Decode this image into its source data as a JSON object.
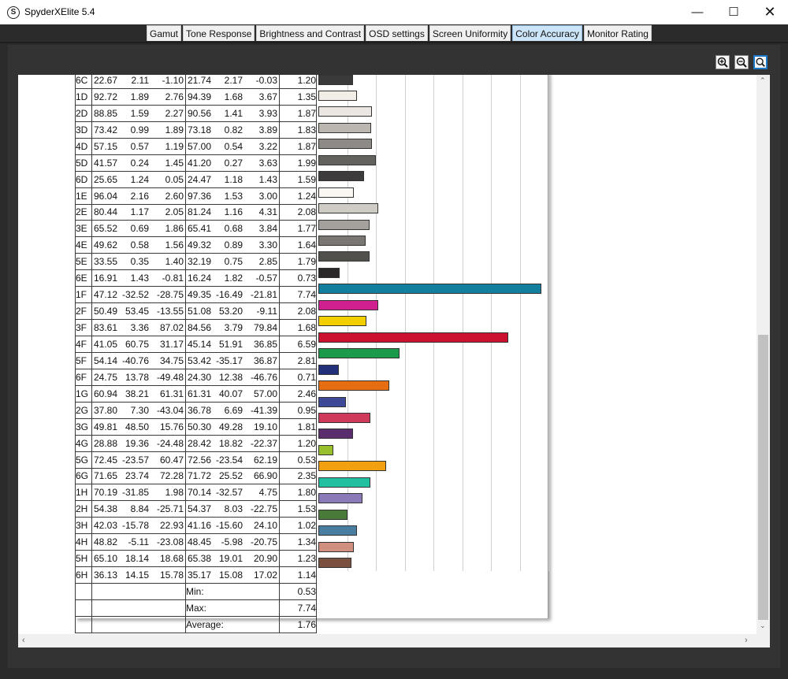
{
  "window": {
    "title": "SpyderXElite 5.4",
    "icon": "S",
    "buttons": {
      "minimize": "—",
      "maximize": "☐",
      "close": "✕"
    }
  },
  "tabs": [
    {
      "label": "Gamut",
      "active": false
    },
    {
      "label": "Tone Response",
      "active": false
    },
    {
      "label": "Brightness and Contrast",
      "active": false
    },
    {
      "label": "OSD settings",
      "active": false
    },
    {
      "label": "Screen Uniformity",
      "active": false
    },
    {
      "label": "Color Accuracy",
      "active": true
    },
    {
      "label": "Monitor Rating",
      "active": false
    }
  ],
  "zoom_controls": [
    "zoom-in-icon",
    "zoom-out-icon",
    "zoom-fit-icon"
  ],
  "scrollbar": {
    "vertical_position": 0.83
  },
  "chart_data": {
    "type": "bar",
    "title": "",
    "xlim": [
      0,
      8
    ],
    "rows": [
      {
        "id": "6C",
        "L": "22.67",
        "a": "2.11",
        "b": "-1.10",
        "L2": "21.74",
        "a2": "2.17",
        "b2": "-0.03",
        "de": 1.2,
        "color": "#3a3a3a"
      },
      {
        "id": "1D",
        "L": "92.72",
        "a": "1.89",
        "b": "2.76",
        "L2": "94.39",
        "a2": "1.68",
        "b2": "3.67",
        "de": 1.35,
        "color": "#f3ede7"
      },
      {
        "id": "2D",
        "L": "88.85",
        "a": "1.59",
        "b": "2.27",
        "L2": "90.56",
        "a2": "1.41",
        "b2": "3.93",
        "de": 1.87,
        "color": "#ebe6e1"
      },
      {
        "id": "3D",
        "L": "73.42",
        "a": "0.99",
        "b": "1.89",
        "L2": "73.18",
        "a2": "0.82",
        "b2": "3.89",
        "de": 1.83,
        "color": "#bbb6b0"
      },
      {
        "id": "4D",
        "L": "57.15",
        "a": "0.57",
        "b": "1.19",
        "L2": "57.00",
        "a2": "0.54",
        "b2": "3.22",
        "de": 1.87,
        "color": "#8e8b86"
      },
      {
        "id": "5D",
        "L": "41.57",
        "a": "0.24",
        "b": "1.45",
        "L2": "41.20",
        "a2": "0.27",
        "b2": "3.63",
        "de": 1.99,
        "color": "#64625e"
      },
      {
        "id": "6D",
        "L": "25.65",
        "a": "1.24",
        "b": "0.05",
        "L2": "24.47",
        "a2": "1.18",
        "b2": "1.43",
        "de": 1.59,
        "color": "#3d3b3b"
      },
      {
        "id": "1E",
        "L": "96.04",
        "a": "2.16",
        "b": "2.60",
        "L2": "97.36",
        "a2": "1.53",
        "b2": "3.00",
        "de": 1.24,
        "color": "#faf6f2"
      },
      {
        "id": "2E",
        "L": "80.44",
        "a": "1.17",
        "b": "2.05",
        "L2": "81.24",
        "a2": "1.16",
        "b2": "4.31",
        "de": 2.08,
        "color": "#cfcbc5"
      },
      {
        "id": "3E",
        "L": "65.52",
        "a": "0.69",
        "b": "1.86",
        "L2": "65.41",
        "a2": "0.68",
        "b2": "3.84",
        "de": 1.77,
        "color": "#a4a09b"
      },
      {
        "id": "4E",
        "L": "49.62",
        "a": "0.58",
        "b": "1.56",
        "L2": "49.32",
        "a2": "0.89",
        "b2": "3.30",
        "de": 1.64,
        "color": "#7a7772"
      },
      {
        "id": "5E",
        "L": "33.55",
        "a": "0.35",
        "b": "1.40",
        "L2": "32.19",
        "a2": "0.75",
        "b2": "2.85",
        "de": 1.79,
        "color": "#51504d"
      },
      {
        "id": "6E",
        "L": "16.91",
        "a": "1.43",
        "b": "-0.81",
        "L2": "16.24",
        "a2": "1.82",
        "b2": "-0.57",
        "de": 0.73,
        "color": "#2a2828"
      },
      {
        "id": "1F",
        "L": "47.12",
        "a": "-32.52",
        "b": "-28.75",
        "L2": "49.35",
        "a2": "-16.49",
        "b2": "-21.81",
        "de": 7.74,
        "color": "#127f9f"
      },
      {
        "id": "2F",
        "L": "50.49",
        "a": "53.45",
        "b": "-13.55",
        "L2": "51.08",
        "a2": "53.20",
        "b2": "-9.11",
        "de": 2.08,
        "color": "#d0208f"
      },
      {
        "id": "3F",
        "L": "83.61",
        "a": "3.36",
        "b": "87.02",
        "L2": "84.56",
        "a2": "3.79",
        "b2": "79.84",
        "de": 1.68,
        "color": "#f2cf00"
      },
      {
        "id": "4F",
        "L": "41.05",
        "a": "60.75",
        "b": "31.17",
        "L2": "45.14",
        "a2": "51.91",
        "b2": "36.85",
        "de": 6.59,
        "color": "#cc1030"
      },
      {
        "id": "5F",
        "L": "54.14",
        "a": "-40.76",
        "b": "34.75",
        "L2": "53.42",
        "a2": "-35.17",
        "b2": "36.87",
        "de": 2.81,
        "color": "#1a9a4a"
      },
      {
        "id": "6F",
        "L": "24.75",
        "a": "13.78",
        "b": "-49.48",
        "L2": "24.30",
        "a2": "12.38",
        "b2": "-46.76",
        "de": 0.71,
        "color": "#22307a"
      },
      {
        "id": "1G",
        "L": "60.94",
        "a": "38.21",
        "b": "61.31",
        "L2": "61.31",
        "a2": "40.07",
        "b2": "57.00",
        "de": 2.46,
        "color": "#e66e10"
      },
      {
        "id": "2G",
        "L": "37.80",
        "a": "7.30",
        "b": "-43.04",
        "L2": "36.78",
        "a2": "6.69",
        "b2": "-41.39",
        "de": 0.95,
        "color": "#3e4a98"
      },
      {
        "id": "3G",
        "L": "49.81",
        "a": "48.50",
        "b": "15.76",
        "L2": "50.30",
        "a2": "49.28",
        "b2": "19.10",
        "de": 1.81,
        "color": "#d03a5a"
      },
      {
        "id": "4G",
        "L": "28.88",
        "a": "19.36",
        "b": "-24.48",
        "L2": "28.42",
        "a2": "18.82",
        "b2": "-22.37",
        "de": 1.2,
        "color": "#5a2e6e"
      },
      {
        "id": "5G",
        "L": "72.45",
        "a": "-23.57",
        "b": "60.47",
        "L2": "72.56",
        "a2": "-23.54",
        "b2": "62.19",
        "de": 0.53,
        "color": "#98c02a"
      },
      {
        "id": "6G",
        "L": "71.65",
        "a": "23.74",
        "b": "72.28",
        "L2": "71.72",
        "a2": "25.52",
        "b2": "66.90",
        "de": 2.35,
        "color": "#f2a010"
      },
      {
        "id": "1H",
        "L": "70.19",
        "a": "-31.85",
        "b": "1.98",
        "L2": "70.14",
        "a2": "-32.57",
        "b2": "4.75",
        "de": 1.8,
        "color": "#20c0a0"
      },
      {
        "id": "2H",
        "L": "54.38",
        "a": "8.84",
        "b": "-25.71",
        "L2": "54.37",
        "a2": "8.03",
        "b2": "-22.75",
        "de": 1.53,
        "color": "#8a7ab8"
      },
      {
        "id": "3H",
        "L": "42.03",
        "a": "-15.78",
        "b": "22.93",
        "L2": "41.16",
        "a2": "-15.60",
        "b2": "24.10",
        "de": 1.02,
        "color": "#4a7a3a"
      },
      {
        "id": "4H",
        "L": "48.82",
        "a": "-5.11",
        "b": "-23.08",
        "L2": "48.45",
        "a2": "-5.98",
        "b2": "-20.75",
        "de": 1.34,
        "color": "#4a7ea0"
      },
      {
        "id": "5H",
        "L": "65.10",
        "a": "18.14",
        "b": "18.68",
        "L2": "65.38",
        "a2": "19.01",
        "b2": "20.90",
        "de": 1.23,
        "color": "#d09080"
      },
      {
        "id": "6H",
        "L": "36.13",
        "a": "14.15",
        "b": "15.78",
        "L2": "35.17",
        "a2": "15.08",
        "b2": "17.02",
        "de": 1.14,
        "color": "#7a5040"
      }
    ],
    "summary": [
      {
        "label": "Min:",
        "value": "0.53"
      },
      {
        "label": "Max:",
        "value": "7.74"
      },
      {
        "label": "Average:",
        "value": "1.76"
      }
    ]
  }
}
